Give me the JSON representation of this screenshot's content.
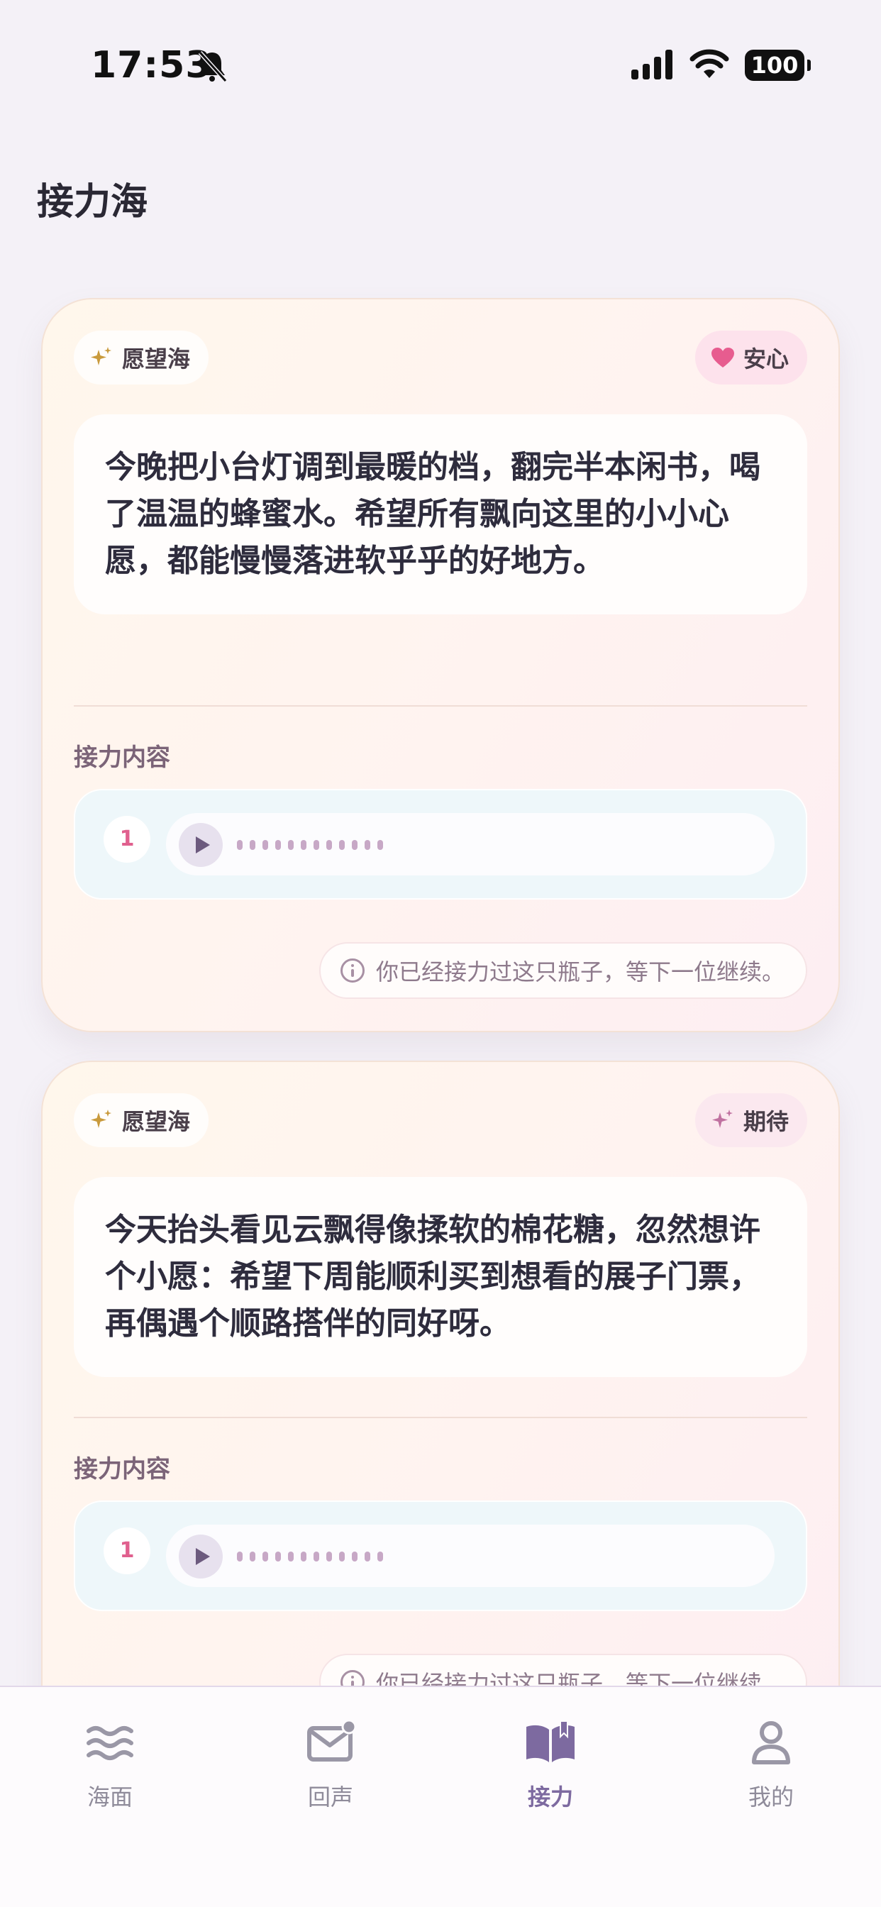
{
  "status": {
    "time": "17:53",
    "battery": "100"
  },
  "page": {
    "title": "接力海"
  },
  "cards": [
    {
      "tag_left": "愿望海",
      "tag_right": "安心",
      "text": "今晚把小台灯调到最暖的档，翻完半本闲书，喝了温温的蜂蜜水。希望所有飘向这里的小小心愿，都能慢慢落进软乎乎的好地方。",
      "section_label": "接力内容",
      "relay_index": "1",
      "notice": "你已经接力过这只瓶子，等下一位继续。"
    },
    {
      "tag_left": "愿望海",
      "tag_right": "期待",
      "text": "今天抬头看见云飘得像揉软的棉花糖，忽然想许个小愿：希望下周能顺利买到想看的展子门票，再偶遇个顺路搭伴的同好呀。",
      "section_label": "接力内容",
      "relay_index": "1",
      "notice": "你已经接力过这只瓶子，等下一位继续。"
    }
  ],
  "tabbar": {
    "items": [
      {
        "label": "海面",
        "icon": "waves-icon"
      },
      {
        "label": "回声",
        "icon": "mail-icon"
      },
      {
        "label": "接力",
        "icon": "book-icon",
        "active": true
      },
      {
        "label": "我的",
        "icon": "user-icon"
      }
    ]
  },
  "colors": {
    "accent": "#7d6aa0",
    "heart": "#e75c8f",
    "sparkle": "#c99a3c"
  }
}
